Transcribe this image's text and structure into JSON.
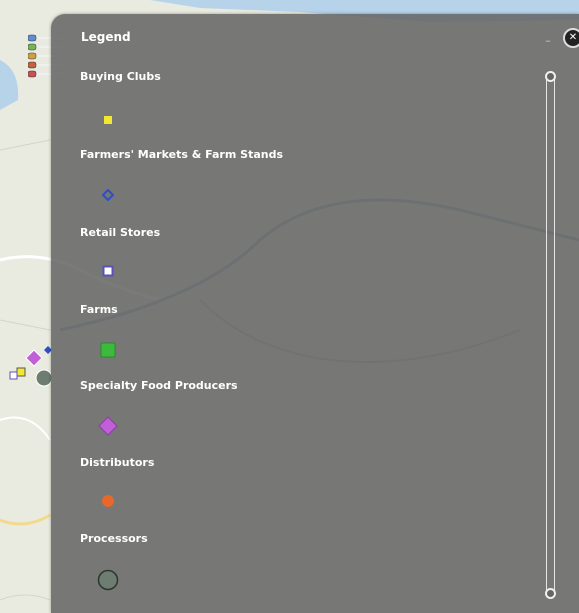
{
  "legend": {
    "title": "Legend",
    "collapse_icon": "minimize-icon",
    "close_icon": "close-icon",
    "items": [
      {
        "label": "Buying Clubs",
        "symbol": "yellow-square",
        "color": "#f2e830"
      },
      {
        "label": "Farmers' Markets & Farm Stands",
        "symbol": "blue-diamond",
        "color": "#2d4fc4"
      },
      {
        "label": "Retail Stores",
        "symbol": "white-square-purple-outline",
        "color": "#ffffff"
      },
      {
        "label": "Farms",
        "symbol": "green-square",
        "color": "#3dba3d"
      },
      {
        "label": "Specialty Food Producers",
        "symbol": "purple-diamond",
        "color": "#c05fd8"
      },
      {
        "label": "Distributors",
        "symbol": "orange-circle",
        "color": "#e8672a"
      },
      {
        "label": "Processors",
        "symbol": "gray-circle",
        "color": "#6e7d72"
      }
    ]
  },
  "layers_button": {
    "icon": "layers-list-icon"
  },
  "colors": {
    "panel": "#646464",
    "text": "#ffffff",
    "scroll": "#e6e6e6"
  }
}
